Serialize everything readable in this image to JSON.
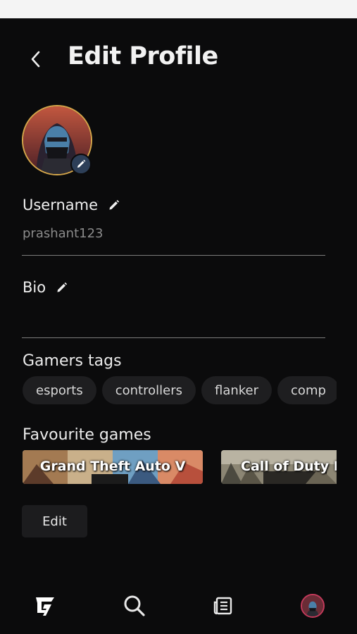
{
  "header": {
    "title": "Edit Profile",
    "back_icon": "chevron-left-icon"
  },
  "profile": {
    "avatar_icon": "avatar",
    "avatar_edit_icon": "pencil-icon",
    "username_label": "Username",
    "username_value": "prashant123",
    "bio_label": "Bio",
    "bio_value": ""
  },
  "tags": {
    "title": "Gamers tags",
    "items": [
      "esports",
      "controllers",
      "flanker",
      "comp"
    ]
  },
  "games": {
    "title": "Favourite games",
    "items": [
      {
        "title": "Grand Theft Auto V"
      },
      {
        "title": "Call of Duty M"
      }
    ]
  },
  "actions": {
    "edit_label": "Edit"
  },
  "nav": {
    "items": [
      "logo-icon",
      "search-icon",
      "news-icon",
      "profile-avatar"
    ]
  },
  "colors": {
    "background": "#0b0b0c",
    "avatar_ring": "#d4a64a",
    "edit_badge": "#2d3f58",
    "nav_avatar_ring": "#c43a5a"
  }
}
